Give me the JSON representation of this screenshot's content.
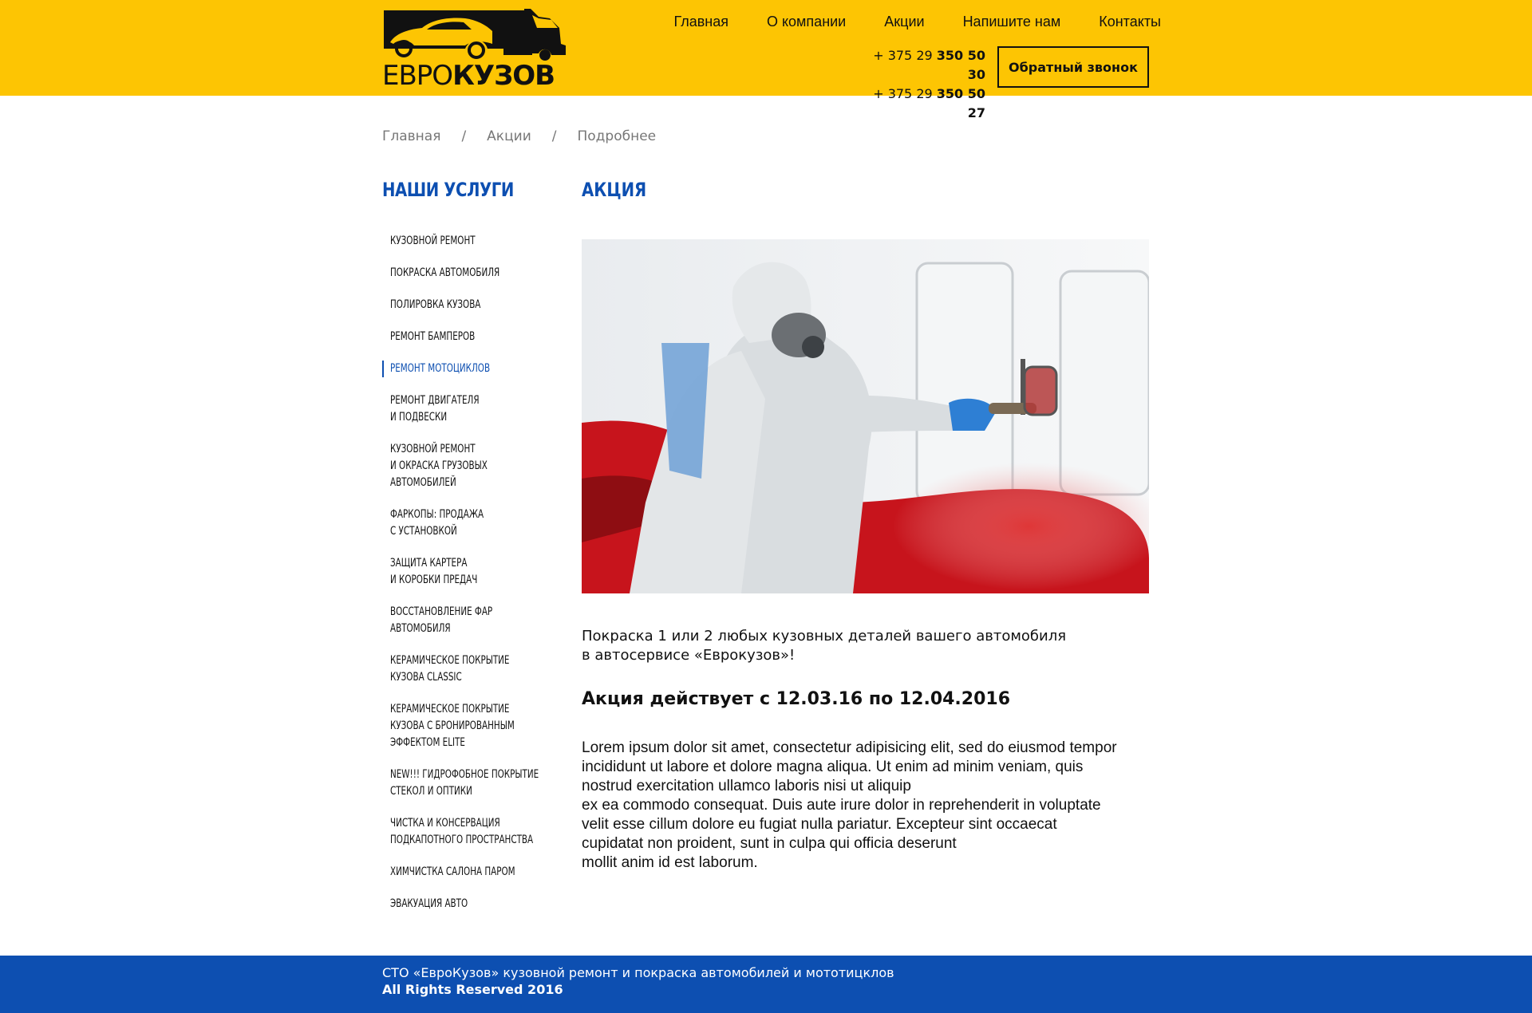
{
  "header": {
    "logo_text_part1": "ЕВРО",
    "logo_text_part2": "КУЗОВ",
    "nav": [
      "Главная",
      "О компании",
      "Акции",
      "Напишите нам",
      "Контакты"
    ],
    "phones": [
      {
        "prefix": "+ 375 29 ",
        "number": "350 50 30"
      },
      {
        "prefix": "+ 375 29 ",
        "number": "350 50 27"
      }
    ],
    "callback_label": "Обратный звонок",
    "bg_color": "#fdc503"
  },
  "breadcrumb": [
    "Главная",
    "Акции",
    "Подробнее"
  ],
  "sidebar": {
    "title": "НАШИ УСЛУГИ",
    "items": [
      {
        "lines": [
          "Кузовной ремонт"
        ]
      },
      {
        "lines": [
          "Покраска автомобиля"
        ]
      },
      {
        "lines": [
          "Полировка кузова"
        ]
      },
      {
        "lines": [
          "Ремонт бамперов"
        ]
      },
      {
        "lines": [
          "Ремонт мотоциклов"
        ],
        "active": true
      },
      {
        "lines": [
          "Ремонт двигателя",
          "и подвески"
        ]
      },
      {
        "lines": [
          "Кузовной ремонт",
          "и окраска грузовых",
          "автомобилей"
        ]
      },
      {
        "lines": [
          "Фаркопы: продажа",
          "с установкой"
        ]
      },
      {
        "lines": [
          "Защита картера",
          "и коробки предач"
        ]
      },
      {
        "lines": [
          "Восстановление фар",
          "автомобиля"
        ]
      },
      {
        "lines": [
          "Керамическое покрытие",
          "кузова Classic"
        ]
      },
      {
        "lines": [
          "Керамическое покрытие",
          "кузова с бронированным",
          "эффектом Elite"
        ]
      },
      {
        "lines": [
          "NEW!!! Гидрофобное покрытие",
          "стекол и оптики"
        ]
      },
      {
        "lines": [
          "Чистка и консервация",
          "подкапотного пространства"
        ]
      },
      {
        "lines": [
          "Химчистка салона паром"
        ]
      },
      {
        "lines": [
          "Эвакуация авто"
        ]
      }
    ]
  },
  "main": {
    "title": "АКЦИЯ",
    "intro_lines": [
      "Покраска 1 или 2 любых кузовных деталей вашего автомобиля",
      "в автосервисе «Еврокузов»!"
    ],
    "promo_dates": "Акция действует с 12.03.16 по 12.04.2016",
    "lorem_lines": [
      "Lorem ipsum dolor sit amet, consectetur adipisicing elit, sed do eiusmod tempor",
      "incididunt ut labore et dolore magna aliqua. Ut enim ad minim veniam, quis",
      "nostrud exercitation ullamco laboris nisi ut aliquip",
      "ex ea commodo consequat. Duis aute irure dolor in reprehenderit in voluptate",
      "velit esse cillum dolore eu fugiat nulla pariatur. Excepteur sint occaecat",
      "cupidatat non proident, sunt in culpa qui officia deserunt",
      "mollit anim id est laborum."
    ]
  },
  "footer": {
    "line1": "СТО «ЕвроКузов» кузовной ремонт и покраска автомобилей и мототицклов",
    "line2": "All Rights Reserved 2016",
    "bg_color": "#0d4fb1"
  }
}
